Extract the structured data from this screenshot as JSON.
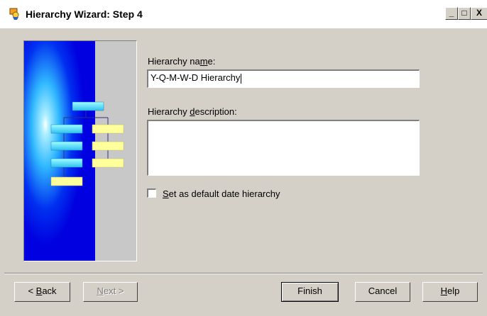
{
  "window": {
    "title": "Hierarchy Wizard: Step 4",
    "title_icon": "wizard-icon",
    "controls": {
      "minimize": "_",
      "maximize": "□",
      "close": "X"
    }
  },
  "form": {
    "name_label_pre": "Hierarchy na",
    "name_label_mnemonic": "m",
    "name_label_post": "e:",
    "name_value": "Y-Q-M-W-D Hierarchy",
    "desc_label_pre": "Hierarchy ",
    "desc_label_mnemonic": "d",
    "desc_label_post": "escription:",
    "desc_value": "",
    "default_checkbox_mnemonic": "S",
    "default_checkbox_label_post": "et as default date hierarchy",
    "default_checkbox_checked": false
  },
  "buttons": {
    "back_prefix": "< ",
    "back_mnemonic": "B",
    "back_rest": "ack",
    "next_mnemonic": "N",
    "next_rest": "ext >",
    "finish": "Finish",
    "cancel": "Cancel",
    "help_mnemonic": "H",
    "help_rest": "elp"
  },
  "colors": {
    "dialog_bg": "#d4d0c8",
    "art_blue": "#0000e0",
    "art_cyan": "#40c8ff",
    "art_yellow": "#ffff9c"
  }
}
